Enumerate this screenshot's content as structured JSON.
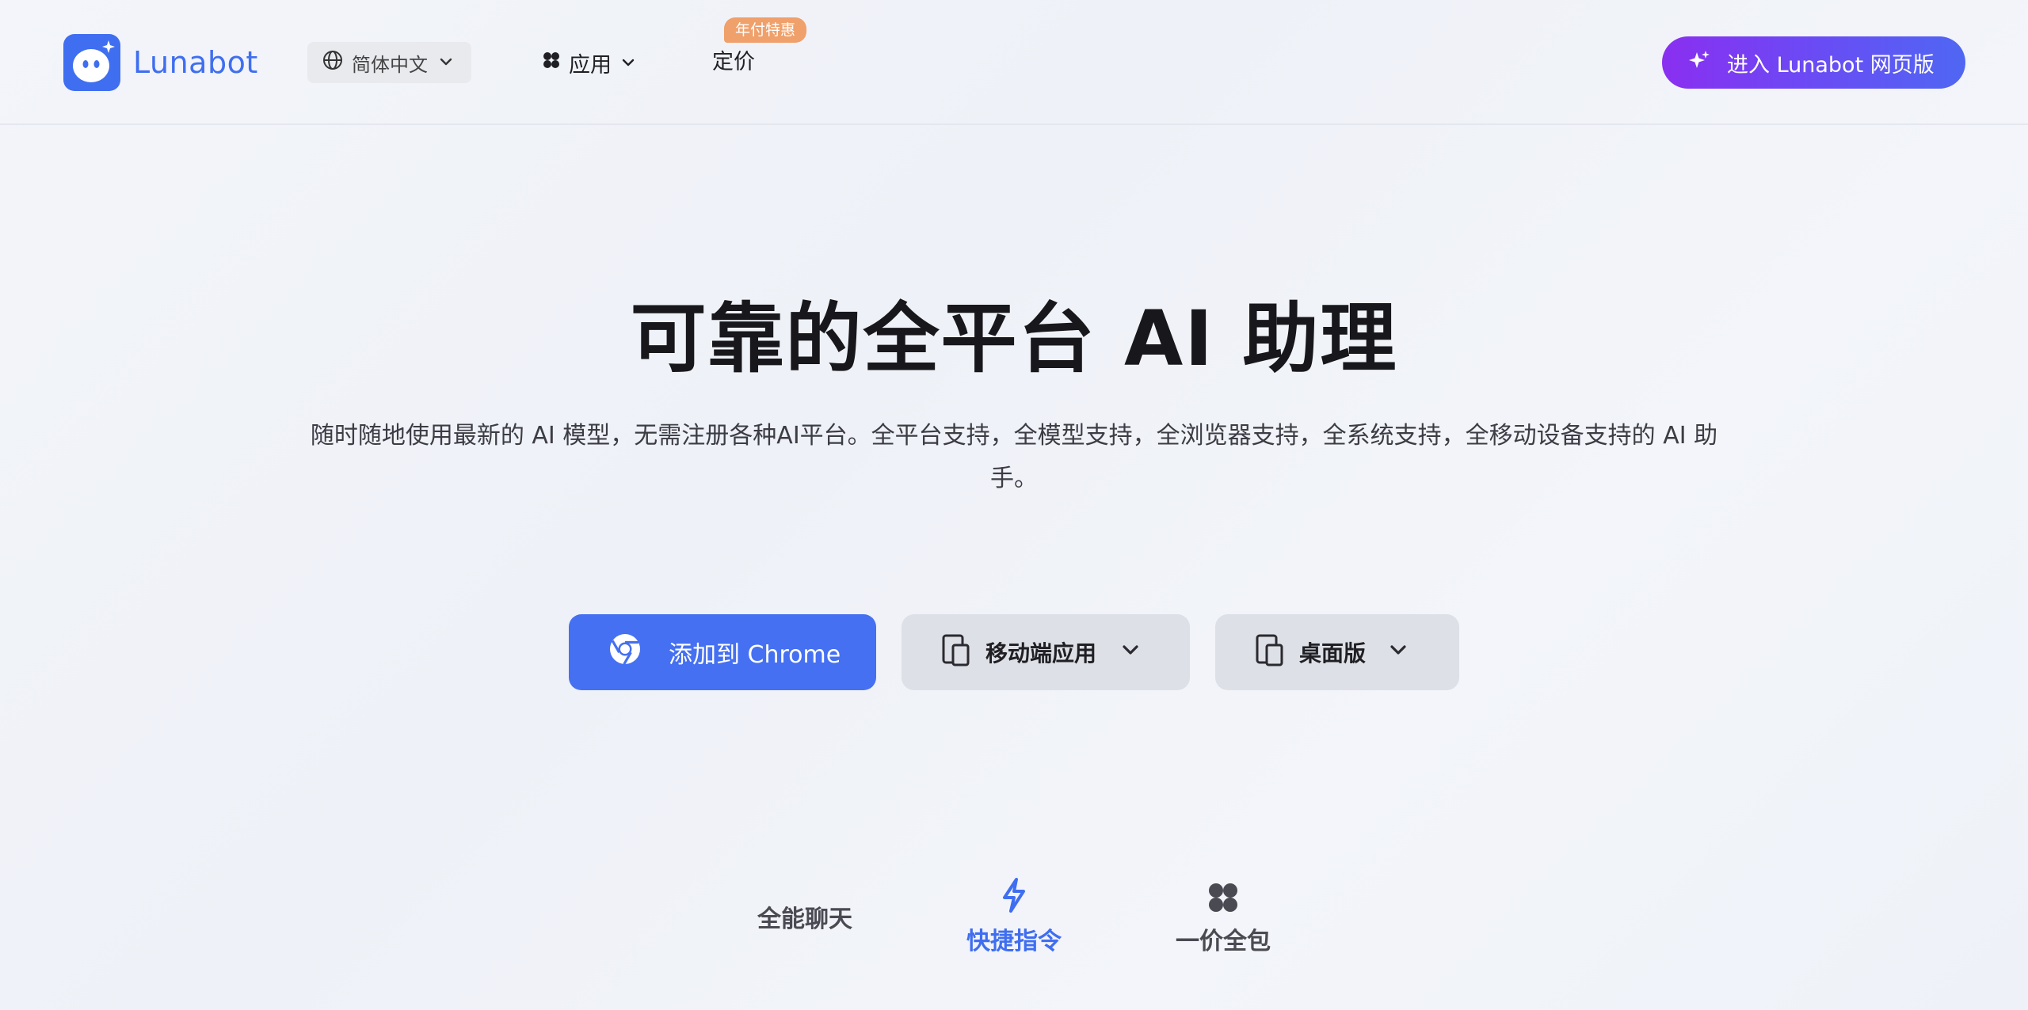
{
  "header": {
    "brand_name": "Lunabot",
    "language_label": "简体中文",
    "nav_apps_label": "应用",
    "nav_pricing_label": "定价",
    "promo_badge": "年付特惠",
    "cta_web_label": "进入 Lunabot 网页版"
  },
  "hero": {
    "title": "可靠的全平台 AI 助理",
    "subtitle": "随时随地使用最新的 AI 模型，无需注册各种AI平台。全平台支持，全模型支持，全浏览器支持，全系统支持，全移动设备支持的 AI 助手。"
  },
  "buttons": {
    "chrome_label": "添加到 Chrome",
    "mobile_label": "移动端应用",
    "desktop_label": "桌面版"
  },
  "features": {
    "tabs": [
      {
        "label": "全能聊天",
        "icon": "chat-icon"
      },
      {
        "label": "快捷指令",
        "icon": "lightning-icon",
        "active": true
      },
      {
        "label": "一价全包",
        "icon": "grid-icon"
      }
    ]
  },
  "colors": {
    "brand": "#3f6ef0",
    "cta_gradient_start": "#8a2ff0",
    "cta_gradient_end": "#4f67f3",
    "promo": "#f0a06a"
  }
}
